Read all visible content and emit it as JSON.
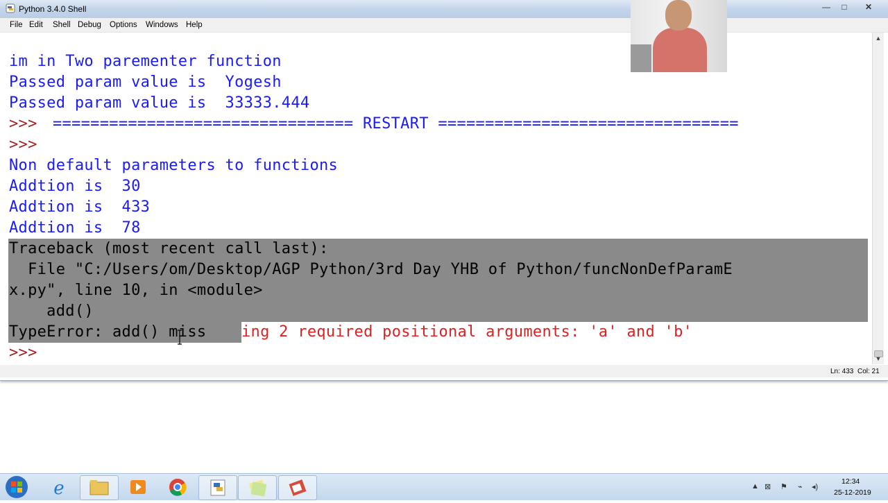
{
  "window": {
    "title": "Python 3.4.0 Shell",
    "controls": {
      "minimize": "—",
      "maximize": "□",
      "close": "✕"
    }
  },
  "menu": [
    "File",
    "Edit",
    "Shell",
    "Debug",
    "Options",
    "Windows",
    "Help"
  ],
  "shell": {
    "lines": [
      "im in Two parementer function",
      "Passed param value is  Yogesh",
      "Passed param value is  33333.444",
      ">>> ",
      "================================ RESTART ================================",
      ">>> ",
      "Non default parameters to functions",
      "Addtion is  30",
      "Addtion is  433",
      "Addtion is  78",
      "Traceback (most recent call last):",
      "  File \"C:/Users/om/Desktop/AGP Python/3rd Day YHB of Python/funcNonDefParamE",
      "x.py\", line 10, in <module>",
      "    add()",
      "TypeError: add() miss",
      "ing 2 required positional arguments: 'a' and 'b'",
      ">>> "
    ]
  },
  "status": {
    "ln": "Ln: 433",
    "col": "Col: 21"
  },
  "colors": {
    "output": "#1a1aff",
    "prompt": "#a42222",
    "error": "#dd2222",
    "selection": "#8a8a8a"
  },
  "taskbar": {
    "items": [
      "windows-start-icon",
      "internet-explorer-icon",
      "file-explorer-icon",
      "media-player-icon",
      "chrome-icon",
      "python-idle-icon",
      "sticky-notes-icon",
      "presentation-icon"
    ],
    "clock": {
      "time": "12:34",
      "date": "25-12-2019"
    }
  }
}
